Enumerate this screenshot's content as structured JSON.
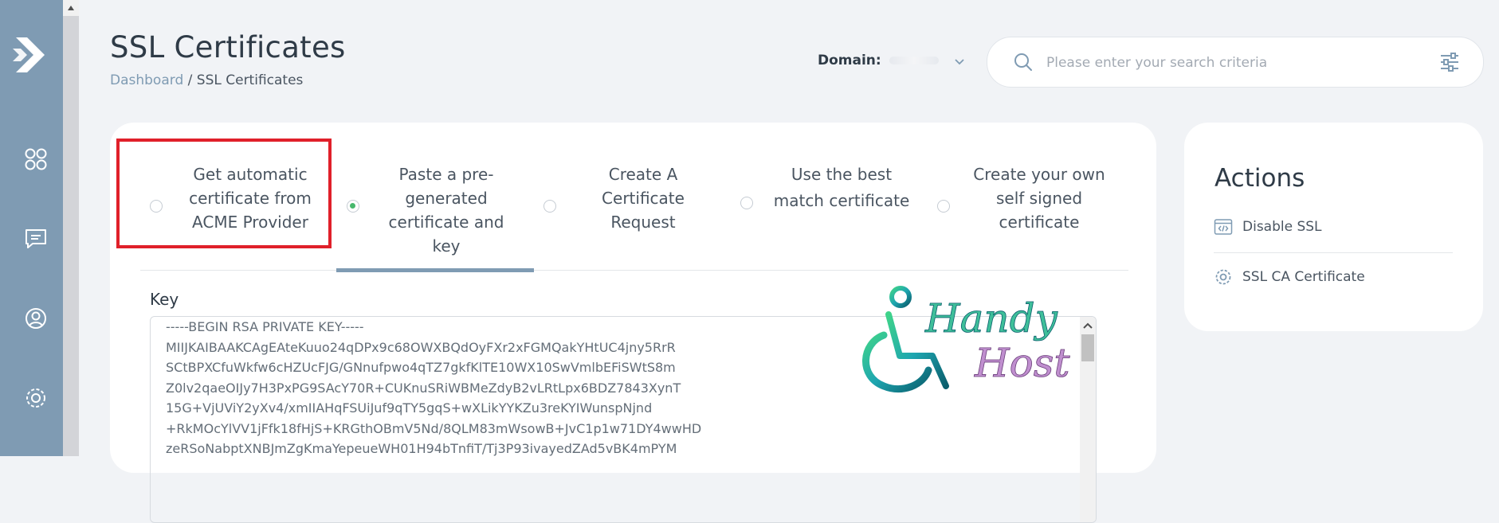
{
  "header": {
    "title": "SSL Certificates",
    "breadcrumb": {
      "home": "Dashboard",
      "separator": " / ",
      "current": "SSL Certificates"
    },
    "domain_label": "Domain:",
    "search": {
      "placeholder": "Please enter your search criteria",
      "value": ""
    }
  },
  "sidebar": {
    "items": [
      {
        "icon": "logo-icon"
      },
      {
        "icon": "grid-icon"
      },
      {
        "icon": "chat-icon"
      },
      {
        "icon": "user-icon"
      },
      {
        "icon": "settings-icon"
      }
    ]
  },
  "tabs": [
    {
      "label_lines": [
        "Get automatic",
        "certificate from",
        "ACME Provider"
      ],
      "selected": false,
      "highlighted": true
    },
    {
      "label_lines": [
        "Paste a pre-",
        "generated",
        "certificate and",
        "key"
      ],
      "selected": true,
      "highlighted": false
    },
    {
      "label_lines": [
        "Create A",
        "Certificate",
        "Request"
      ],
      "selected": false,
      "highlighted": false
    },
    {
      "label_lines": [
        "Use the best",
        "match certificate"
      ],
      "selected": false,
      "highlighted": false
    },
    {
      "label_lines": [
        "Create your own",
        "self signed",
        "certificate"
      ],
      "selected": false,
      "highlighted": false
    }
  ],
  "key_field": {
    "label": "Key",
    "value": "-----BEGIN RSA PRIVATE KEY-----\nMIIJKAIBAAKCAgEAteKuuo24qDPx9c68OWXBQdOyFXr2xFGMQakYHtUC4jny5RrR\nSCtBPXCfuWkfw6cHZUcFJG/GNnufpwo4qTZ7gkfKlTE10WX10SwVmlbEFiSWtS8m\nZ0lv2qaeOIJy7H3PxPG9SAcY70R+CUKnuSRiWBMeZdyB2vLRtLpx6BDZ7843XynT\n15G+VjUViY2yXv4/xmIIAHqFSUiJuf9qTY5gqS+wXLikYYKZu3reKYIWunspNjnd\n+RkMOcYlVV1jFfk18fHjS+KRGthOBmV5Nd/8QLM83mWsowB+JvC1p1w71DY4wwHD\nzeRSoNabptXNBJmZgKmaYepeueWH01H94bTnfiT/Tj3P93ivayedZAd5vBK4mPYM"
  },
  "watermark": {
    "line1": "Handy",
    "line2": "Host"
  },
  "actions": {
    "title": "Actions",
    "items": [
      {
        "label": "Disable SSL",
        "icon": "code-window-icon"
      },
      {
        "label": "SSL CA Certificate",
        "icon": "gear-icon"
      }
    ]
  },
  "colors": {
    "sidebar": "#7f9bb3",
    "accent": "#7f9bb3",
    "radio_selected": "#48b86d",
    "highlight_border": "#e0202a",
    "background": "#f1f3f6"
  }
}
